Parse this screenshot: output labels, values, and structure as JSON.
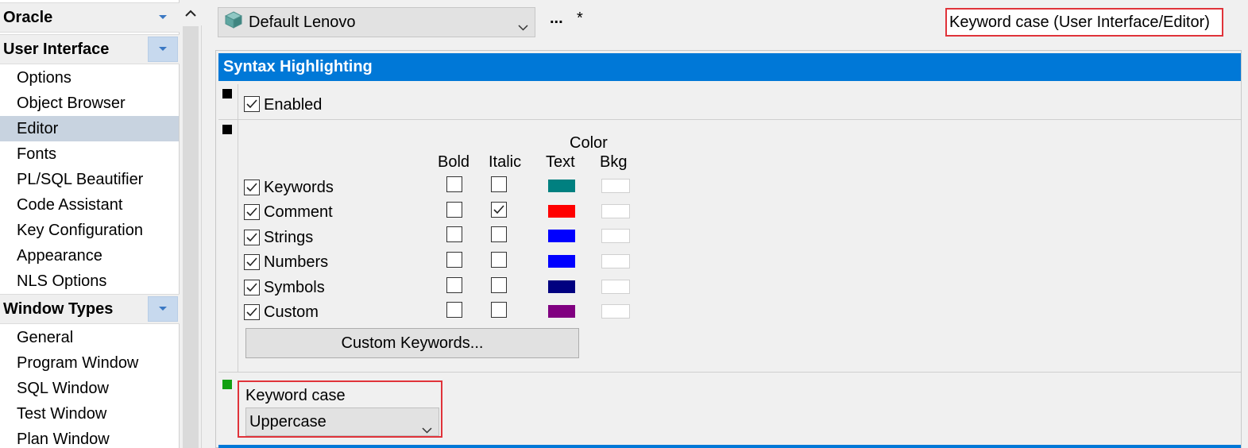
{
  "sidebar": {
    "groups": [
      {
        "title": "Oracle",
        "items": []
      },
      {
        "title": "User Interface",
        "items": [
          "Options",
          "Object Browser",
          "Editor",
          "Fonts",
          "PL/SQL Beautifier",
          "Code Assistant",
          "Key Configuration",
          "Appearance",
          "NLS Options"
        ]
      },
      {
        "title": "Window Types",
        "items": [
          "General",
          "Program Window",
          "SQL Window",
          "Test Window",
          "Plan Window"
        ]
      }
    ],
    "selected_item": "Editor"
  },
  "toolbar": {
    "template_name": "Default Lenovo",
    "ellipsis_label": "...",
    "modified_marker": "*",
    "search_value": "Keyword case (User Interface/Editor)"
  },
  "section": {
    "title": "Syntax Highlighting",
    "enabled_label": "Enabled",
    "enabled_checked": true,
    "columns": {
      "color_header": "Color",
      "bold": "Bold",
      "italic": "Italic",
      "text": "Text",
      "bkg": "Bkg"
    },
    "rows": [
      {
        "label": "Keywords",
        "checked": true,
        "bold": false,
        "italic": false,
        "text_color": "#008080",
        "bkg_color": "#ffffff"
      },
      {
        "label": "Comment",
        "checked": true,
        "bold": false,
        "italic": true,
        "text_color": "#ff0000",
        "bkg_color": "#ffffff"
      },
      {
        "label": "Strings",
        "checked": true,
        "bold": false,
        "italic": false,
        "text_color": "#0000ff",
        "bkg_color": "#ffffff"
      },
      {
        "label": "Numbers",
        "checked": true,
        "bold": false,
        "italic": false,
        "text_color": "#0000ff",
        "bkg_color": "#ffffff"
      },
      {
        "label": "Symbols",
        "checked": true,
        "bold": false,
        "italic": false,
        "text_color": "#000080",
        "bkg_color": "#ffffff"
      },
      {
        "label": "Custom",
        "checked": true,
        "bold": false,
        "italic": false,
        "text_color": "#800080",
        "bkg_color": "#ffffff"
      }
    ],
    "custom_keywords_button": "Custom Keywords..."
  },
  "keyword_case": {
    "label": "Keyword case",
    "value": "Uppercase"
  },
  "colors": {
    "accent": "#0078d7",
    "highlight_border": "#e0333a",
    "selected_item_bg": "#c8d3e0",
    "changed_marker": "#12a012"
  },
  "icons": {
    "template": "cube-icon",
    "dropdown": "chevron-down-icon",
    "scroll_up": "chevron-up-icon"
  }
}
